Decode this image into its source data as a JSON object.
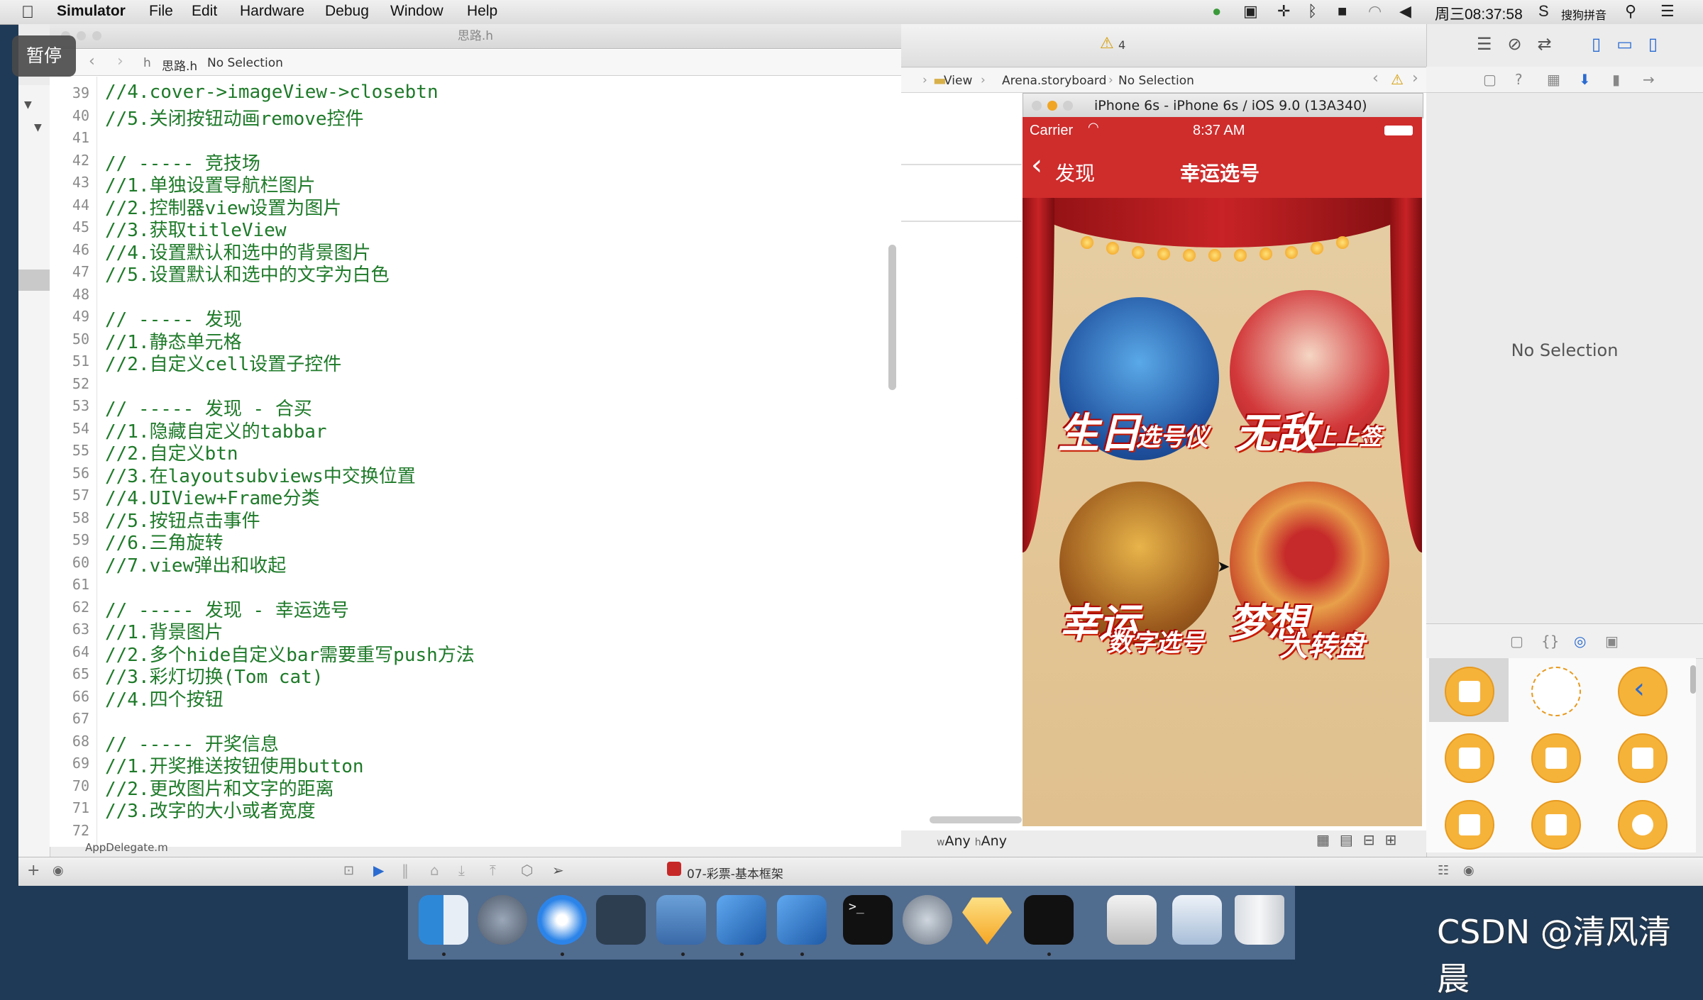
{
  "menubar": {
    "app_name": "Simulator",
    "menus": [
      "File",
      "Edit",
      "Hardware",
      "Debug",
      "Window",
      "Help"
    ],
    "clock": "周三08:37:58",
    "input_method": "搜狗拼音"
  },
  "pause_badge": "暂停",
  "editor": {
    "window_title": "思路.h",
    "jump_file": "思路.h",
    "jump_selection": "No Selection",
    "lines": [
      {
        "n": "39",
        "t": "//4.cover->imageView->closebtn"
      },
      {
        "n": "40",
        "t": "//5.关闭按钮动画remove控件"
      },
      {
        "n": "41",
        "t": ""
      },
      {
        "n": "42",
        "t": "// ----- 竞技场"
      },
      {
        "n": "43",
        "t": "//1.单独设置导航栏图片"
      },
      {
        "n": "44",
        "t": "//2.控制器view设置为图片"
      },
      {
        "n": "45",
        "t": "//3.获取titleView"
      },
      {
        "n": "46",
        "t": "//4.设置默认和选中的背景图片"
      },
      {
        "n": "47",
        "t": "//5.设置默认和选中的文字为白色"
      },
      {
        "n": "48",
        "t": ""
      },
      {
        "n": "49",
        "t": "// ----- 发现"
      },
      {
        "n": "50",
        "t": "//1.静态单元格"
      },
      {
        "n": "51",
        "t": "//2.自定义cell设置子控件"
      },
      {
        "n": "52",
        "t": ""
      },
      {
        "n": "53",
        "t": "// ----- 发现 - 合买"
      },
      {
        "n": "54",
        "t": "//1.隐藏自定义的tabbar"
      },
      {
        "n": "55",
        "t": "//2.自定义btn"
      },
      {
        "n": "56",
        "t": "//3.在layoutsubviews中交换位置"
      },
      {
        "n": "57",
        "t": "//4.UIView+Frame分类"
      },
      {
        "n": "58",
        "t": "//5.按钮点击事件"
      },
      {
        "n": "59",
        "t": "//6.三角旋转"
      },
      {
        "n": "60",
        "t": "//7.view弹出和收起"
      },
      {
        "n": "61",
        "t": ""
      },
      {
        "n": "62",
        "t": "// ----- 发现 - 幸运选号"
      },
      {
        "n": "63",
        "t": "//1.背景图片"
      },
      {
        "n": "64",
        "t": "//2.多个hide自定义bar需要重写push方法"
      },
      {
        "n": "65",
        "t": "//3.彩灯切换(Tom cat)"
      },
      {
        "n": "66",
        "t": "//4.四个按钮"
      },
      {
        "n": "67",
        "t": ""
      },
      {
        "n": "68",
        "t": "// ----- 开奖信息"
      },
      {
        "n": "69",
        "t": "//1.开奖推送按钮使用button"
      },
      {
        "n": "70",
        "t": "//2.更改图片和文字的距离"
      },
      {
        "n": "71",
        "t": "//3.改字的大小或者宽度"
      },
      {
        "n": "72",
        "t": ""
      }
    ],
    "file_below": "AppDelegate.m"
  },
  "middle": {
    "warning_count": "4",
    "jump": [
      "View",
      "Arena.storyboard",
      "No Selection"
    ],
    "size_class_w": "Any",
    "size_class_h": "Any"
  },
  "simulator": {
    "title": "iPhone 6s - iPhone 6s / iOS 9.0 (13A340)",
    "carrier": "Carrier",
    "time": "8:37 AM",
    "back_label": "发现",
    "nav_title": "幸运选号",
    "buttons": [
      {
        "line1": "生日",
        "line2": "选号仪"
      },
      {
        "line1": "无敌",
        "line2": "上上签"
      },
      {
        "line1": "幸运",
        "line2": "数字选号"
      },
      {
        "line1": "梦想",
        "line2": "大转盘"
      }
    ]
  },
  "inspector": {
    "no_selection": "No Selection"
  },
  "bottom_bar": {
    "scheme": "07-彩票-基本框架"
  },
  "watermark": "CSDN @清风清晨"
}
